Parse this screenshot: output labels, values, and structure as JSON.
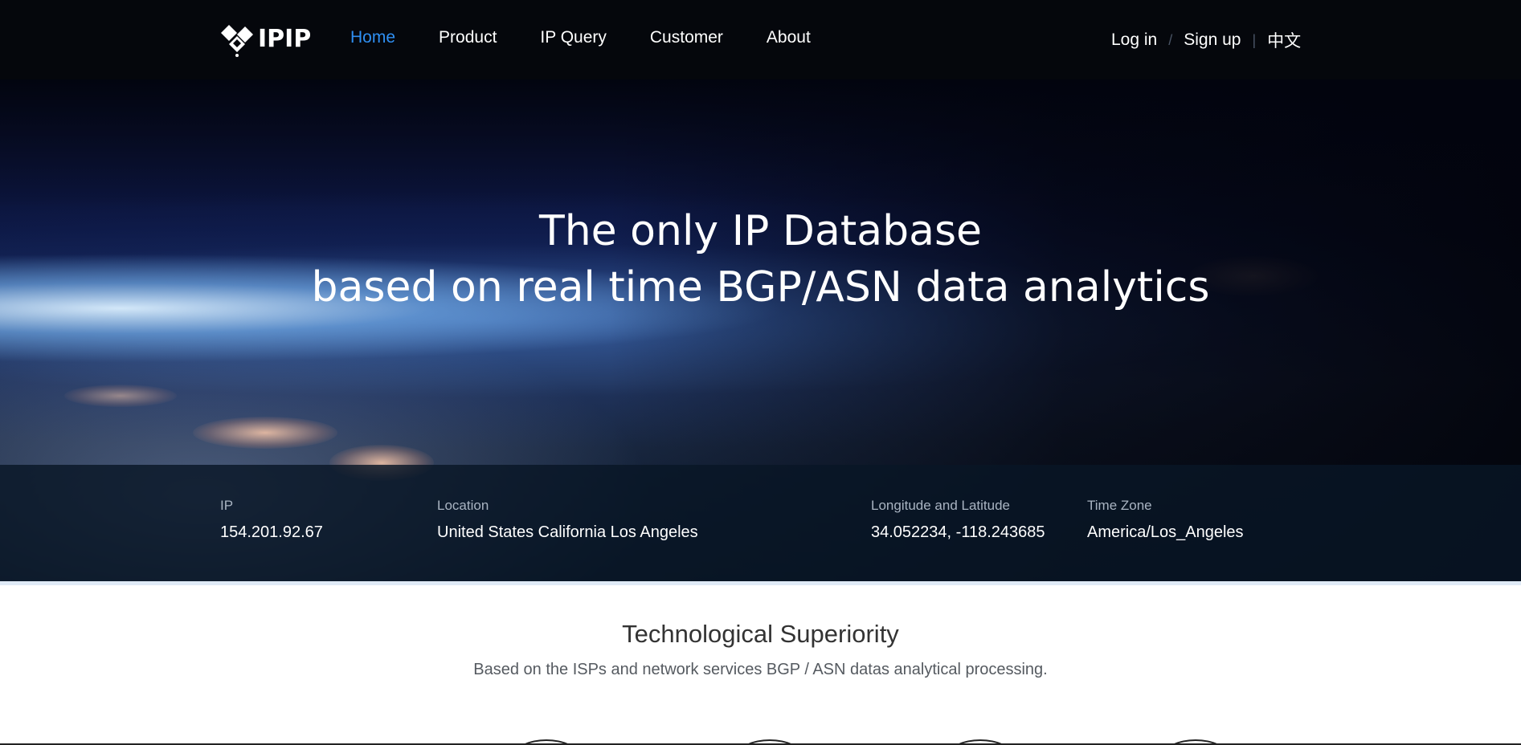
{
  "brand": {
    "name": "IPIP",
    "logo_icon": "ipip-diamond-logo"
  },
  "nav": {
    "items": [
      {
        "label": "Home",
        "active": true
      },
      {
        "label": "Product",
        "active": false
      },
      {
        "label": "IP Query",
        "active": false
      },
      {
        "label": "Customer",
        "active": false
      },
      {
        "label": "About",
        "active": false
      }
    ],
    "login": "Log in",
    "divider1": "/",
    "signup": "Sign up",
    "divider2": "|",
    "language": "中文"
  },
  "hero": {
    "line1": "The only IP Database",
    "line2": "based on real time BGP/ASN data analytics"
  },
  "info": {
    "ip_label": "IP",
    "ip_value": "154.201.92.67",
    "location_label": "Location",
    "location_value": "United States California Los Angeles",
    "coords_label": "Longitude and Latitude",
    "coords_value": "34.052234, -118.243685",
    "tz_label": "Time Zone",
    "tz_value": "America/Los_Angeles"
  },
  "section": {
    "title": "Technological Superiority",
    "subtitle": "Based on the ISPs and network services BGP / ASN datas analytical processing."
  },
  "colors": {
    "nav_bg": "#05070c",
    "active_link": "#2f8ff2",
    "info_bar_bg": "#081626",
    "section_title": "#333333"
  }
}
